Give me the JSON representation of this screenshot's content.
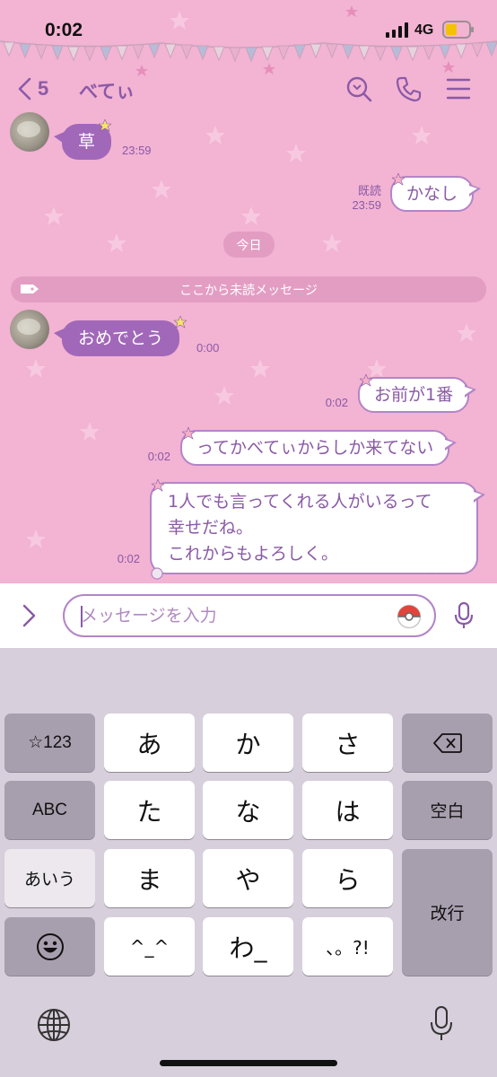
{
  "status_bar": {
    "time": "0:02",
    "network": "4G"
  },
  "header": {
    "back_count": "5",
    "contact_name": "べてぃ"
  },
  "messages": [
    {
      "text": "草",
      "time": "23:59",
      "read": ""
    },
    {
      "text": "かなし",
      "time": "23:59",
      "read": "既読"
    },
    {
      "text": "おめでとう",
      "time": "0:00"
    },
    {
      "text": "お前が1番",
      "time": "0:02"
    },
    {
      "text": "ってかべてぃからしか来てない",
      "time": "0:02"
    },
    {
      "text_lines": [
        "1人でも言ってくれる人がいるって",
        "幸せだね。",
        "これからもよろしく。"
      ],
      "time": "0:02"
    }
  ],
  "date_divider": "今日",
  "unread_divider": "ここから未読メッセージ",
  "input": {
    "placeholder": "メッセージを入力",
    "value": ""
  },
  "keyboard": {
    "symbols": "☆123",
    "abc": "ABC",
    "kana_mode": "あいう",
    "row1": [
      "あ",
      "か",
      "さ"
    ],
    "row2": [
      "た",
      "な",
      "は"
    ],
    "row3": [
      "ま",
      "や",
      "ら"
    ],
    "row4": [
      "^_^",
      "わ_",
      "、。?!"
    ],
    "space": "空白",
    "return": "改行"
  },
  "colors": {
    "chat_bg": "#f3b3d3",
    "accent": "#8a5aa6",
    "incoming_bubble": "#a168b9",
    "keyboard_bg": "#d7cfdc"
  },
  "icons": [
    "chevron-left-icon",
    "search-icon",
    "phone-icon",
    "menu-icon",
    "chevron-right-icon",
    "stamp-icon",
    "mic-icon",
    "backspace-icon",
    "emoji-icon",
    "globe-icon",
    "dictation-icon",
    "signal-icon",
    "battery-icon"
  ]
}
